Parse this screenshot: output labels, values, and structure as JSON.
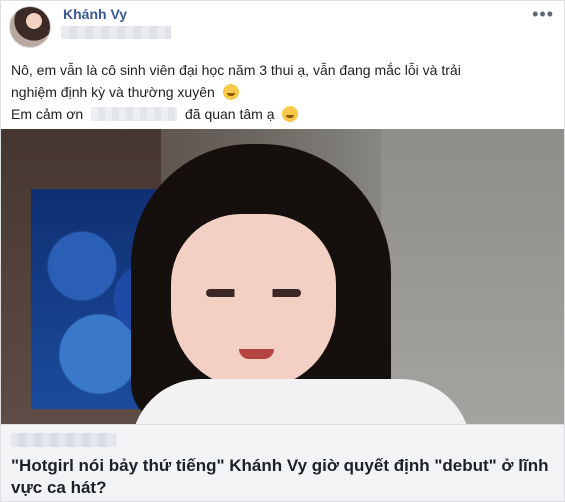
{
  "post": {
    "author": "Khánh Vy",
    "more_label": "•••",
    "text_lines": [
      "Nô, em vẫn là cô sinh viên đại học năm 3 thui ạ, vẫn đang mắc lỗi và trải",
      "nghiệm định kỳ và thường xuyên",
      "Em cảm ơn",
      "đã quan tâm ạ"
    ]
  },
  "link_preview": {
    "title": "\"Hotgirl nói bảy thứ tiếng\" Khánh Vy giờ quyết định \"debut\" ở lĩnh vực ca hát?"
  }
}
